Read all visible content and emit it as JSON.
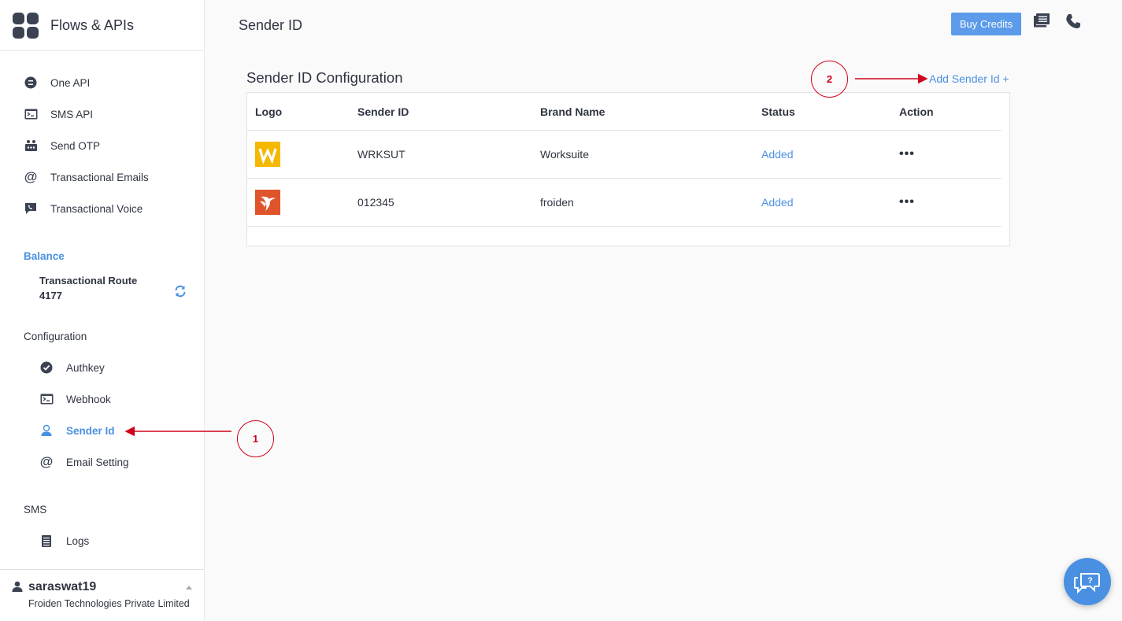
{
  "app": {
    "title": "Flows & APIs"
  },
  "nav": [
    {
      "label": "One API",
      "icon": "api-icon"
    },
    {
      "label": "SMS API",
      "icon": "sms-api-icon"
    },
    {
      "label": "Send OTP",
      "icon": "otp-icon"
    },
    {
      "label": "Transactional Emails",
      "icon": "at-icon"
    },
    {
      "label": "Transactional Voice",
      "icon": "voice-icon"
    }
  ],
  "balance": {
    "title": "Balance",
    "route_label": "Transactional Route",
    "route_value": "4177"
  },
  "configuration": {
    "title": "Configuration",
    "items": [
      {
        "label": "Authkey",
        "icon": "check-badge-icon"
      },
      {
        "label": "Webhook",
        "icon": "terminal-icon"
      },
      {
        "label": "Sender Id",
        "icon": "user-badge-icon",
        "active": true
      },
      {
        "label": "Email Setting",
        "icon": "at-icon"
      }
    ]
  },
  "sms": {
    "title": "SMS",
    "items": [
      {
        "label": "Logs",
        "icon": "logs-icon"
      }
    ]
  },
  "user": {
    "name": "saraswat19",
    "org": "Froiden Technologies Private Limited"
  },
  "header": {
    "title": "Sender ID",
    "buy_credits": "Buy Credits"
  },
  "card": {
    "title": "Sender ID Configuration",
    "add_link": "Add Sender Id +",
    "columns": [
      "Logo",
      "Sender ID",
      "Brand Name",
      "Status",
      "Action"
    ],
    "rows": [
      {
        "sender_id": "WRKSUT",
        "brand": "Worksuite",
        "status": "Added",
        "action": "•••"
      },
      {
        "sender_id": "012345",
        "brand": "froiden",
        "status": "Added",
        "action": "•••"
      }
    ]
  },
  "annotations": {
    "one": "1",
    "two": "2"
  },
  "colors": {
    "accent": "#4a90e2",
    "button": "#5b9bea",
    "annotation": "#d0021b",
    "worksuite_logo": "#f5b800",
    "froiden_logo": "#e0542b"
  }
}
